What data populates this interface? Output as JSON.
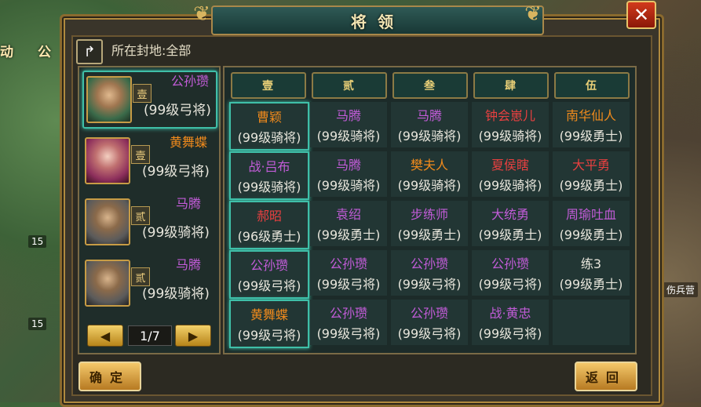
{
  "background": {
    "left_tag": "动",
    "left_tag2": "公",
    "label_right": "伤兵营",
    "label_15a": "15",
    "label_15b": "15"
  },
  "window": {
    "title": "将领",
    "close_icon": "close-x-icon"
  },
  "fief_label": "所在封地:全部",
  "heroes": [
    {
      "name": "公孙瓒",
      "rank": "壹",
      "level": "(99级弓将)",
      "color": "purple",
      "selected": true
    },
    {
      "name": "黄舞蝶",
      "rank": "壹",
      "level": "(99级弓将)",
      "color": "orange",
      "selected": false
    },
    {
      "name": "马腾",
      "rank": "贰",
      "level": "(99级骑将)",
      "color": "purple",
      "selected": false
    },
    {
      "name": "马腾",
      "rank": "贰",
      "level": "(99级骑将)",
      "color": "purple",
      "selected": false
    }
  ],
  "pager": {
    "text": "1/7",
    "prev_icon": "triangle-left-icon",
    "next_icon": "triangle-right-icon"
  },
  "columns": [
    "壹",
    "贰",
    "叁",
    "肆",
    "伍"
  ],
  "grid": [
    [
      {
        "name": "曹颖",
        "level": "(99级骑将)",
        "color": "orange"
      },
      {
        "name": "马腾",
        "level": "(99级骑将)",
        "color": "purple"
      },
      {
        "name": "马腾",
        "level": "(99级骑将)",
        "color": "purple"
      },
      {
        "name": "钟会崽儿",
        "level": "(99级骑将)",
        "color": "red"
      },
      {
        "name": "南华仙人",
        "level": "(99级勇士)",
        "color": "orange"
      }
    ],
    [
      {
        "name": "战·吕布",
        "level": "(99级骑将)",
        "color": "purple"
      },
      {
        "name": "马腾",
        "level": "(99级骑将)",
        "color": "purple"
      },
      {
        "name": "樊夫人",
        "level": "(99级骑将)",
        "color": "orange"
      },
      {
        "name": "夏侯瞎",
        "level": "(99级骑将)",
        "color": "red"
      },
      {
        "name": "大平勇",
        "level": "(99级勇士)",
        "color": "red"
      }
    ],
    [
      {
        "name": "郝昭",
        "level": "(96级勇士)",
        "color": "red"
      },
      {
        "name": "袁绍",
        "level": "(99级勇士)",
        "color": "purple"
      },
      {
        "name": "步练师",
        "level": "(99级勇士)",
        "color": "purple"
      },
      {
        "name": "大统勇",
        "level": "(99级勇士)",
        "color": "purple"
      },
      {
        "name": "周瑜吐血",
        "level": "(99级勇士)",
        "color": "purple"
      }
    ],
    [
      {
        "name": "公孙瓒",
        "level": "(99级弓将)",
        "color": "purple"
      },
      {
        "name": "公孙瓒",
        "level": "(99级弓将)",
        "color": "purple"
      },
      {
        "name": "公孙瓒",
        "level": "(99级弓将)",
        "color": "purple"
      },
      {
        "name": "公孙瓒",
        "level": "(99级弓将)",
        "color": "purple"
      },
      {
        "name": "练3",
        "level": "(99级勇士)",
        "color": "white"
      }
    ],
    [
      {
        "name": "黄舞蝶",
        "level": "(99级弓将)",
        "color": "orange"
      },
      {
        "name": "公孙瓒",
        "level": "(99级弓将)",
        "color": "purple"
      },
      {
        "name": "公孙瓒",
        "level": "(99级弓将)",
        "color": "purple"
      },
      {
        "name": "战·黄忠",
        "level": "(99级弓将)",
        "color": "purple"
      },
      {
        "name": "",
        "level": "",
        "color": "white"
      }
    ]
  ],
  "buttons": {
    "confirm": "确定",
    "back": "返回"
  }
}
